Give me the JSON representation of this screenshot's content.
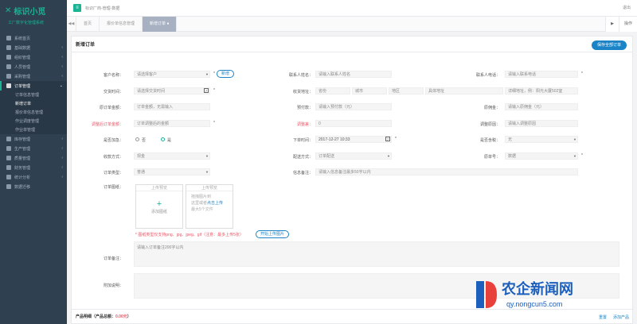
{
  "brand": {
    "title": "标识小觅",
    "subtitle": "工厂数字化管理系统"
  },
  "sidebar": {
    "items": [
      {
        "label": "系统首页"
      },
      {
        "label": "基础数据"
      },
      {
        "label": "组织管理"
      },
      {
        "label": "人员管理"
      },
      {
        "label": "采购管理"
      },
      {
        "label": "订单管理"
      },
      {
        "label": "库存管理"
      },
      {
        "label": "生产管理"
      },
      {
        "label": "质量管理"
      },
      {
        "label": "财务管理"
      },
      {
        "label": "统计分析"
      },
      {
        "label": "数据迁移"
      }
    ],
    "subitems": [
      {
        "label": "订单信息管理"
      },
      {
        "label": "新增订单"
      },
      {
        "label": "报价单信息管理"
      },
      {
        "label": "作业调度管理"
      },
      {
        "label": "作业单管理"
      }
    ]
  },
  "topbar": {
    "title": "标识厂商-管理-数据",
    "user": "退出"
  },
  "tabs": {
    "prev": "◀◀",
    "home": "首页",
    "t1": "报价单信息管理",
    "t2": "新增订单",
    "next": "▶",
    "ops": "操作"
  },
  "page": {
    "title": "新增订单",
    "save": "保存全部订单"
  },
  "form": {
    "customer_label": "客户名称：",
    "customer_val": "请选择客户",
    "add_btn": "新增",
    "contact_label": "联系人姓名：",
    "contact_val": "请输入联系人姓名",
    "phone_label": "联系人电话：",
    "phone_val": "请输入联系电话",
    "delivery_label": "交货时间：",
    "delivery_val": "请选择交货时间",
    "addr_label": "收货地址：",
    "prov": "省份",
    "city": "城市",
    "dist": "地区",
    "addr_detail": "具体地址",
    "addr_extra": "详细地址，例：阳光大厦502室",
    "orig_amount_label": "原订单金额：",
    "orig_amount_val": "订单金额，无需输入",
    "prepay_label": "预付款：",
    "prepay_val": "请输入预付款（元）",
    "cost_label": "原佣金：",
    "cost_val": "请输入原佣金（元）",
    "adjust_label": "调整后订单金额：",
    "adjust_val": "订单调整后的金额",
    "diff_label": "调整差：",
    "diff_val": "0",
    "reason_label": "调整原因：",
    "reason_val": "请输入调整原因",
    "invoice_label": "是否加急：",
    "no": "否",
    "yes": "是",
    "order_time_label": "下单时间：",
    "order_time_val": "2017-12-27 10:33",
    "tax_label": "是否含税：",
    "tax_val": "无",
    "pay_label": "收款方式：",
    "pay_val": "现金",
    "ship_label": "配送方式：",
    "ship_val": "订单配送",
    "source_label": "原单号：",
    "source_val": "数据",
    "ordertype_label": "订单类型：",
    "ordertype_val": "普通",
    "remark_label": "信息备注：",
    "remark_val": "请输入信息备注最多50字以内",
    "img_label": "订单图纸：",
    "up1_head": "上传预览",
    "up1_add": "添加图纸",
    "up2_head": "上传预览",
    "up2_l1": "拖拽图片到",
    "up2_l2": "这里或者",
    "up2_link": "点击上传",
    "up2_l3": "最大5个文件",
    "upload_tip": "* 图纸类型仅支持png、jpg、jpeg、gif（注意：最多上传5张）",
    "upload_btn": "开始上传图片",
    "note_label": "订单备注：",
    "note_val": "请输入订单备注200字以内",
    "extra_label": "附加说明："
  },
  "footer": {
    "title": "产品明细（产品总额：",
    "amount": "0.00元",
    "close": "）",
    "a1": "重置",
    "a2": "添加产品"
  },
  "watermark": {
    "text": "农企新闻网",
    "url": "qy.nongcun5.com"
  }
}
